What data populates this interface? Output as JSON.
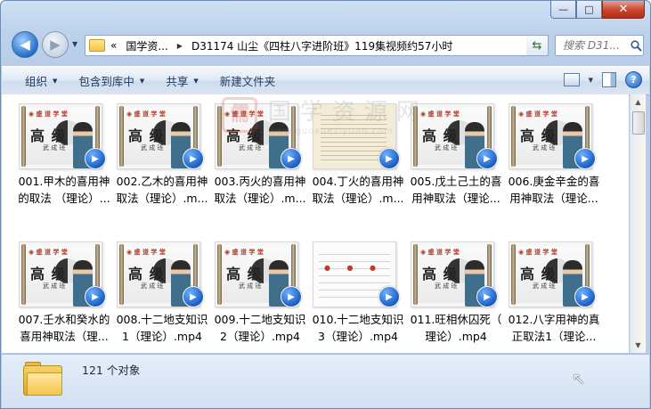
{
  "window": {
    "caption": {
      "minimize": "—",
      "maximize": "□",
      "close": "✕"
    }
  },
  "nav": {
    "back_icon": "◀",
    "forward_icon": "▶",
    "history_icon": "▼",
    "address": {
      "overflow": "«",
      "parts": [
        "国学资...",
        "D31174 山尘《四柱八字进阶班》119集视频约57小时"
      ],
      "separator": "▶",
      "dropdown_icon": "▼"
    },
    "refresh_icon": "⇆",
    "search": {
      "placeholder": "搜索 D31...",
      "icon": "search-icon"
    }
  },
  "toolbar": {
    "organize": "组织",
    "include": "包含到库中",
    "share": "共享",
    "new_folder": "新建文件夹",
    "dropdown_glyph": "▼",
    "help": "?"
  },
  "files": [
    {
      "line1": "001.甲木的喜用神",
      "line2": "的取法 （理论）...",
      "thumb": "lecture"
    },
    {
      "line1": "002.乙木的喜用神",
      "line2": "取法（理论）.m...",
      "thumb": "lecture"
    },
    {
      "line1": "003.丙火的喜用神",
      "line2": "取法（理论）.m...",
      "thumb": "lecture"
    },
    {
      "line1": "004.丁火的喜用神",
      "line2": "取法（理论）.m...",
      "thumb": "doc"
    },
    {
      "line1": "005.戊土己土的喜",
      "line2": "用神取法（理论...",
      "thumb": "lecture"
    },
    {
      "line1": "006.庚金辛金的喜",
      "line2": "用神取法（理论...",
      "thumb": "lecture"
    },
    {
      "line1": "007.壬水和癸水的",
      "line2": "喜用神取法（理...",
      "thumb": "lecture"
    },
    {
      "line1": "008.十二地支知识",
      "line2": "1（理论）.mp4",
      "thumb": "lecture"
    },
    {
      "line1": "009.十二地支知识",
      "line2": "2（理论）.mp4",
      "thumb": "lecture"
    },
    {
      "line1": "010.十二地支知识",
      "line2": "3（理论）.mp4",
      "thumb": "chart"
    },
    {
      "line1": "011.旺相休囚死（",
      "line2": "理论）.mp4",
      "thumb": "lecture"
    },
    {
      "line1": "012.八字用神的真",
      "line2": "正取法1（理论...",
      "thumb": "lecture"
    }
  ],
  "thumbnail_text": {
    "banner": "◉ 盛 道 学 堂",
    "big": "高 级",
    "sub": "武 成 班"
  },
  "video_badge": "▶",
  "watermark": {
    "logo": "儒",
    "cn": "国学资源网",
    "url": "www.guoxueziyuan.com"
  },
  "scrollbar": {
    "up": "▲",
    "down": "▼"
  },
  "status": {
    "count": "121 个对象"
  },
  "cursor": "↖"
}
